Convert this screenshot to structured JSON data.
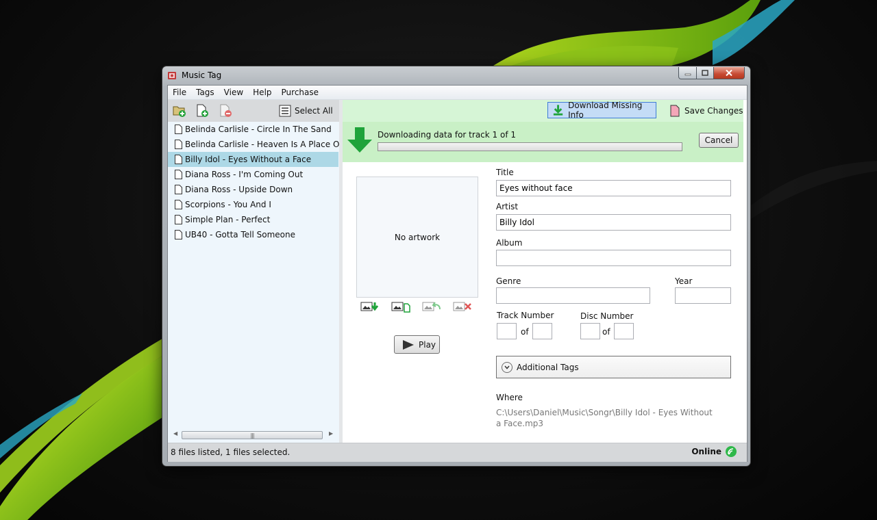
{
  "window": {
    "title": "Music Tag"
  },
  "menu": {
    "items": [
      "File",
      "Tags",
      "View",
      "Help",
      "Purchase"
    ]
  },
  "left_toolbar": {
    "select_all_label": "Select All"
  },
  "files": [
    {
      "name": "Belinda Carlisle - Circle In The Sand",
      "selected": false
    },
    {
      "name": "Belinda Carlisle - Heaven Is A Place On Earth",
      "selected": false
    },
    {
      "name": "Billy Idol - Eyes Without a Face",
      "selected": true
    },
    {
      "name": "Diana Ross - I'm Coming Out",
      "selected": false
    },
    {
      "name": "Diana Ross - Upside Down",
      "selected": false
    },
    {
      "name": "Scorpions - You And I",
      "selected": false
    },
    {
      "name": "Simple Plan - Perfect",
      "selected": false
    },
    {
      "name": "UB40 - Gotta Tell Someone",
      "selected": false
    }
  ],
  "scrollbar": {
    "thumb_grip": "|||"
  },
  "actions": {
    "download_missing_label": "Download Missing Info",
    "save_changes_label": "Save Changes"
  },
  "progress": {
    "text": "Downloading data for track 1 of 1",
    "fraction": 0.0,
    "cancel_label": "Cancel"
  },
  "artwork": {
    "placeholder": "No artwork",
    "play_label": "Play"
  },
  "tags": {
    "title_label": "Title",
    "title_value": "Eyes without face",
    "artist_label": "Artist",
    "artist_value": "Billy Idol",
    "album_label": "Album",
    "album_value": "",
    "genre_label": "Genre",
    "genre_value": "",
    "year_label": "Year",
    "year_value": "",
    "track_label": "Track Number",
    "track_value": "",
    "track_of_label": "of",
    "track_total": "",
    "disc_label": "Disc Number",
    "disc_value": "",
    "disc_of_label": "of",
    "disc_total": "",
    "additional_label": "Additional Tags",
    "where_label": "Where",
    "where_path": "C:\\Users\\Daniel\\Music\\Songr\\Billy Idol - Eyes Without a Face.mp3"
  },
  "status": {
    "text": "8 files listed,  1 files selected.",
    "connection": "Online"
  },
  "colors": {
    "accent_green": "#1fa33a",
    "selection": "#add8e6",
    "action_bar": "#d6f5d6",
    "progress_panel": "#c9f0c6"
  }
}
